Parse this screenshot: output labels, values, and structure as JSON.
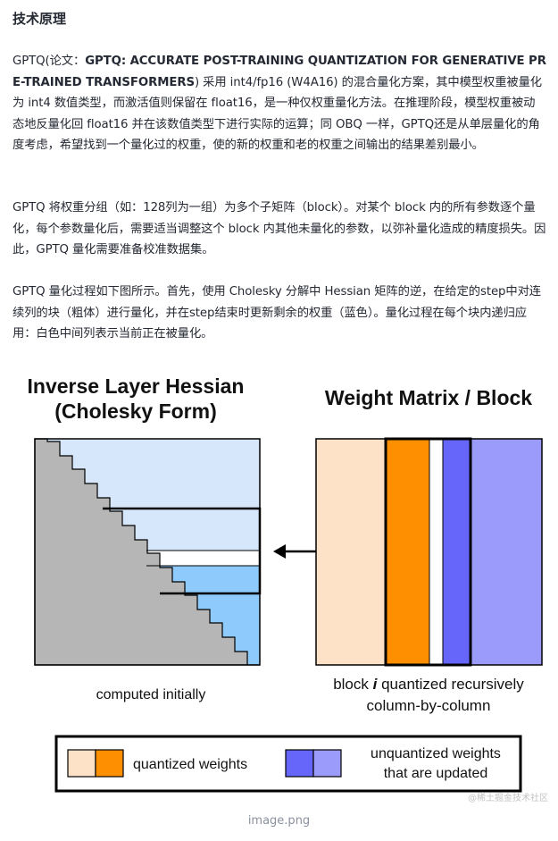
{
  "heading": "技术原理",
  "para1": {
    "prefix": "GPTQ(论文：",
    "bold": "GPTQ: ACCURATE POST-TRAINING QUANTIZATION FOR GENERATIVE PR E-TRAINED TRANSFORMERS",
    "suffix": ") 采用 int4/fp16 (W4A16) 的混合量化方案，其中模型权重被量化为 int4 数值类型，而激活值则保留在 float16，是一种仅权重量化方法。在推理阶段，模型权重被动态地反量化回 float16 并在该数值类型下进行实际的运算；同 OBQ 一样，GPTQ还是从单层量化的角度考虑，希望找到一个量化过的权重，使的新的权重和老的权重之间输出的结果差别最小。"
  },
  "para2": "GPTQ 将权重分组（如：128列为一组）为多个子矩阵（block）。对某个 block 内的所有参数逐个量化，每个参数量化后，需要适当调整这个 block 内其他未量化的参数，以弥补量化造成的精度损失。因此，GPTQ 量化需要准备校准数据集。",
  "para3": "GPTQ 量化过程如下图所示。首先，使用 Cholesky 分解中 Hessian 矩阵的逆，在给定的step中对连续列的块（粗体）进行量化，并在step结束时更新剩余的权重（蓝色）。量化过程在每个块内递归应用：白色中间列表示当前正在被量化。",
  "figure": {
    "left_title_1": "Inverse Layer Hessian",
    "left_title_2": "(Cholesky Form)",
    "right_title": "Weight Matrix / Block",
    "left_caption": "computed initially",
    "right_caption_1a": "block ",
    "right_caption_1b": "i",
    "right_caption_1c": " quantized recursively",
    "right_caption_2": "column-by-column",
    "legend_quantized": "quantized weights",
    "legend_unquantized_1": "unquantized weights",
    "legend_unquantized_2": "that are updated",
    "colors": {
      "light_blue": "#d6e6fb",
      "mid_blue": "#8ecafc",
      "gray": "#b6b6b6",
      "peach": "#fde2c7",
      "orange": "#fe8f01",
      "blue": "#6666fb",
      "lavender": "#9b9bfb"
    }
  },
  "watermark": "@稀土掘金技术社区",
  "caption": "image.png"
}
